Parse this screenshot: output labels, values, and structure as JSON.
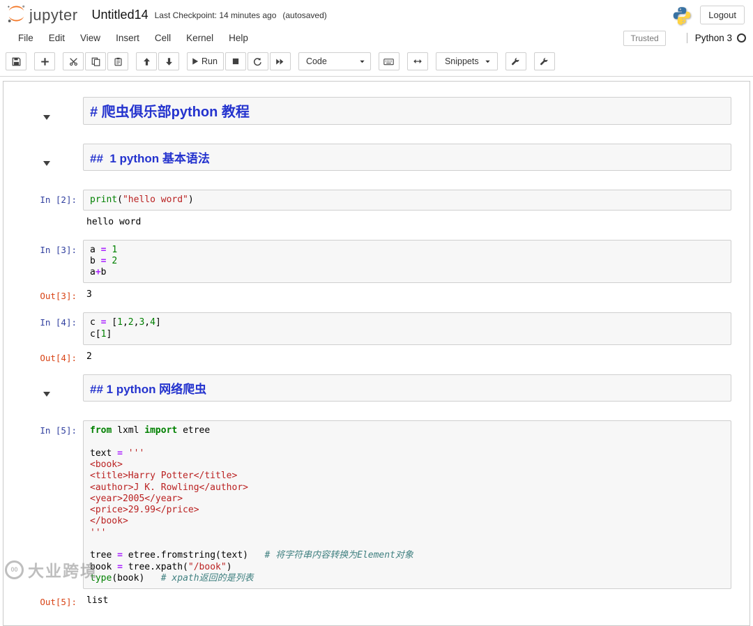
{
  "header": {
    "app_name": "jupyter",
    "title": "Untitled14",
    "checkpoint": "Last Checkpoint: 14 minutes ago",
    "autosaved": "(autosaved)",
    "logout_label": "Logout"
  },
  "menu": {
    "items": [
      "File",
      "Edit",
      "View",
      "Insert",
      "Cell",
      "Kernel",
      "Help"
    ],
    "trusted_label": "Trusted",
    "kernel_name": "Python 3"
  },
  "toolbar": {
    "buttons": [
      {
        "name": "save-button",
        "icon": "save-icon",
        "group": 1
      },
      {
        "name": "add-cell-button",
        "icon": "plus-icon",
        "group": 2
      },
      {
        "name": "cut-cells-button",
        "icon": "scissors-icon",
        "group": 3
      },
      {
        "name": "copy-cells-button",
        "icon": "copy-icon",
        "group": 3
      },
      {
        "name": "paste-cells-button",
        "icon": "paste-icon",
        "group": 3
      },
      {
        "name": "move-cell-up-button",
        "icon": "arrow-up-icon",
        "group": 4
      },
      {
        "name": "move-cell-down-button",
        "icon": "arrow-down-icon",
        "group": 4
      },
      {
        "name": "run-button",
        "icon": "play-icon",
        "label": "Run",
        "group": 5
      },
      {
        "name": "interrupt-kernel-button",
        "icon": "stop-icon",
        "group": 5
      },
      {
        "name": "restart-kernel-button",
        "icon": "refresh-icon",
        "group": 5
      },
      {
        "name": "restart-run-all-button",
        "icon": "fast-forward-icon",
        "group": 5
      },
      {
        "name": "cell-type-select",
        "label": "Code",
        "type": "select",
        "group": 6
      },
      {
        "name": "command-palette-button",
        "icon": "keyboard-icon",
        "group": 7
      },
      {
        "name": "cell-width-button",
        "icon": "arrows-h-icon",
        "group": 8
      },
      {
        "name": "snippets-dropdown",
        "label": "Snippets",
        "type": "dropdown",
        "group": 9
      },
      {
        "name": "nbextensions-button",
        "icon": "wrench-icon",
        "group": 10
      },
      {
        "name": "configurator-button",
        "icon": "wrench-icon",
        "group": 11
      }
    ]
  },
  "cells": [
    {
      "type": "heading",
      "level": 1,
      "arrow": true,
      "text": "# 爬虫俱乐部python 教程"
    },
    {
      "type": "heading",
      "level": 2,
      "arrow": true,
      "text": "##  1 python 基本语法"
    },
    {
      "type": "code",
      "prompt": "In [2]:",
      "lines": [
        [
          [
            "builtin",
            "print"
          ],
          [
            "plain",
            "("
          ],
          [
            "str",
            "\"hello word\""
          ],
          [
            "plain",
            ")"
          ]
        ]
      ],
      "outputs": [
        {
          "kind": "stream",
          "text": "hello word"
        }
      ]
    },
    {
      "type": "code",
      "prompt": "In [3]:",
      "lines": [
        [
          [
            "plain",
            "a "
          ],
          [
            "op",
            "="
          ],
          [
            "plain",
            " "
          ],
          [
            "num",
            "1"
          ]
        ],
        [
          [
            "plain",
            "b "
          ],
          [
            "op",
            "="
          ],
          [
            "plain",
            " "
          ],
          [
            "num",
            "2"
          ]
        ],
        [
          [
            "plain",
            "a"
          ],
          [
            "op",
            "+"
          ],
          [
            "plain",
            "b"
          ]
        ]
      ],
      "outputs": [
        {
          "kind": "result",
          "prompt": "Out[3]:",
          "text": "3"
        }
      ]
    },
    {
      "type": "code",
      "prompt": "In [4]:",
      "lines": [
        [
          [
            "plain",
            "c "
          ],
          [
            "op",
            "="
          ],
          [
            "plain",
            " ["
          ],
          [
            "num",
            "1"
          ],
          [
            "plain",
            ","
          ],
          [
            "num",
            "2"
          ],
          [
            "plain",
            ","
          ],
          [
            "num",
            "3"
          ],
          [
            "plain",
            ","
          ],
          [
            "num",
            "4"
          ],
          [
            "plain",
            "]"
          ]
        ],
        [
          [
            "plain",
            "c["
          ],
          [
            "num",
            "1"
          ],
          [
            "plain",
            "]"
          ]
        ]
      ],
      "outputs": [
        {
          "kind": "result",
          "prompt": "Out[4]:",
          "text": "2"
        }
      ]
    },
    {
      "type": "heading",
      "level": 2,
      "arrow": true,
      "text": "## 1 python 网络爬虫"
    },
    {
      "type": "code",
      "prompt": "In [5]:",
      "lines": [
        [
          [
            "kw",
            "from"
          ],
          [
            "plain",
            " lxml "
          ],
          [
            "kw",
            "import"
          ],
          [
            "plain",
            " etree"
          ]
        ],
        [],
        [
          [
            "plain",
            "text "
          ],
          [
            "op",
            "="
          ],
          [
            "plain",
            " "
          ],
          [
            "str",
            "'''"
          ]
        ],
        [
          [
            "str",
            "<book>"
          ]
        ],
        [
          [
            "str",
            "<title>Harry Potter</title>"
          ]
        ],
        [
          [
            "str",
            "<author>J K. Rowling</author>"
          ]
        ],
        [
          [
            "str",
            "<year>2005</year>"
          ]
        ],
        [
          [
            "str",
            "<price>29.99</price>"
          ]
        ],
        [
          [
            "str",
            "</book>"
          ]
        ],
        [
          [
            "str",
            "'''"
          ]
        ],
        [],
        [
          [
            "plain",
            "tree "
          ],
          [
            "op",
            "="
          ],
          [
            "plain",
            " etree.fromstring(text)   "
          ],
          [
            "com",
            "# 将字符串内容转换为Element对象"
          ]
        ],
        [
          [
            "plain",
            "book "
          ],
          [
            "op",
            "="
          ],
          [
            "plain",
            " tree.xpath("
          ],
          [
            "str",
            "\"/book\""
          ],
          [
            "plain",
            ")"
          ]
        ],
        [
          [
            "builtin",
            "type"
          ],
          [
            "plain",
            "(book)   "
          ],
          [
            "com",
            "# xpath返回的是列表"
          ]
        ]
      ],
      "outputs": [
        {
          "kind": "result",
          "prompt": "Out[5]:",
          "text": "list"
        }
      ]
    }
  ],
  "watermark": {
    "logo_text": "00",
    "text": "大业跨境"
  },
  "colors": {
    "jupyter_orange": "#F37726",
    "heading_blue": "#2433CE",
    "input_prompt_blue": "#303F9F",
    "output_prompt_red": "#D84315",
    "keyword_green": "#008000",
    "string_red": "#BA2121",
    "comment_teal": "#408080",
    "operator_purple": "#AA22FF",
    "cell_bg": "#F7F7F7",
    "cell_border": "#CFCFCF"
  }
}
